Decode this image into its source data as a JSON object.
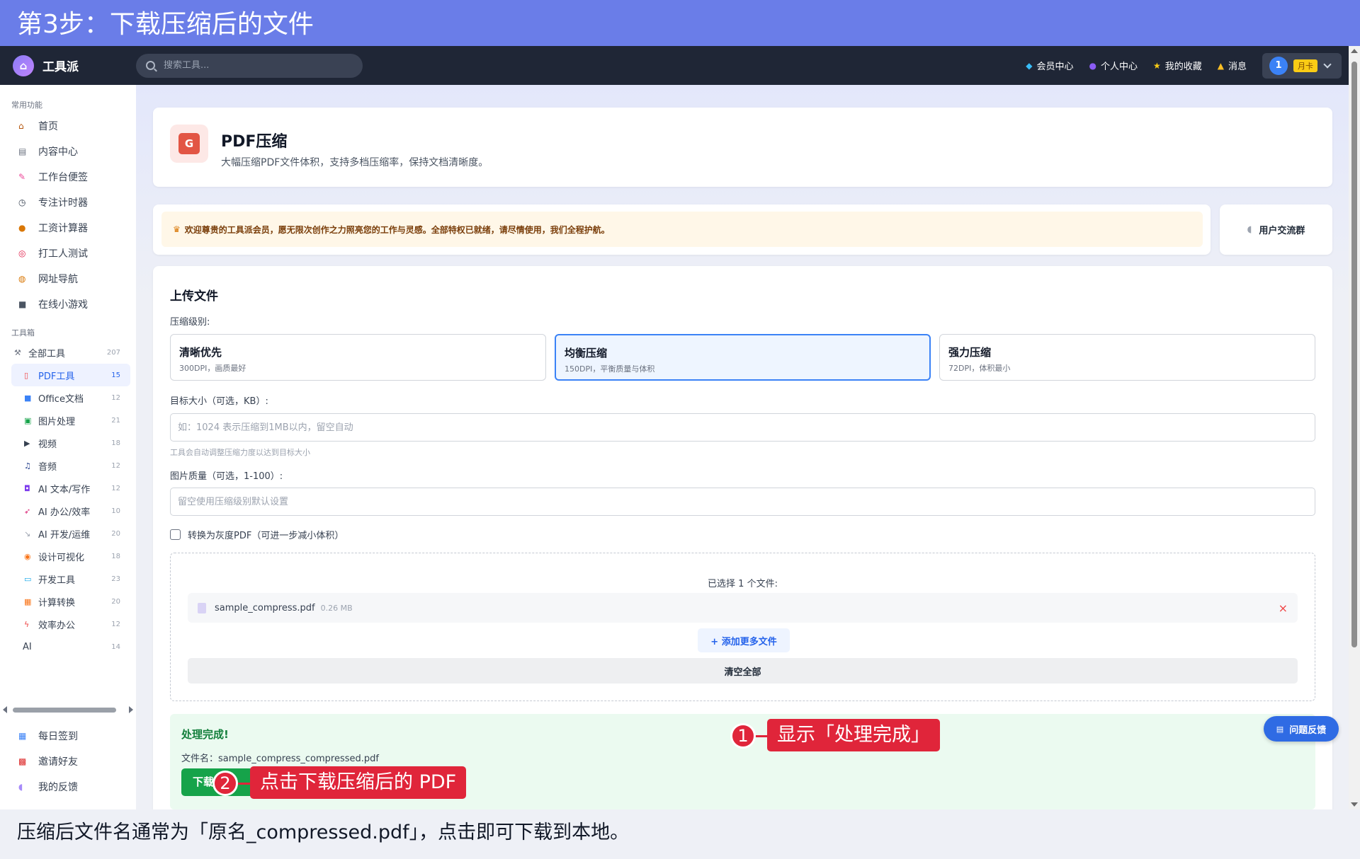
{
  "tutorial": {
    "step_title": "第3步：下载压缩后的文件",
    "caption": "压缩后文件名通常为「原名_compressed.pdf」，点击即可下载到本地。",
    "callouts": [
      {
        "number": "1",
        "text": "显示「处理完成」"
      },
      {
        "number": "2",
        "text": "点击下载压缩后的 PDF"
      }
    ]
  },
  "topnav": {
    "brand": "工具派",
    "search_placeholder": "搜索工具...",
    "links": [
      {
        "icon": "diamond-icon",
        "label": "会员中心"
      },
      {
        "icon": "user-icon",
        "label": "个人中心"
      },
      {
        "icon": "star-icon",
        "label": "我的收藏"
      },
      {
        "icon": "bell-icon",
        "label": "消息"
      }
    ],
    "user": {
      "avatar": "1",
      "plan": "月卡"
    }
  },
  "sidebar": {
    "common_title": "常用功能",
    "common": [
      {
        "icon": "home-icon",
        "label": "首页"
      },
      {
        "icon": "news-icon",
        "label": "内容中心"
      },
      {
        "icon": "memo-icon",
        "label": "工作台便签"
      },
      {
        "icon": "timer-icon",
        "label": "专注计时器"
      },
      {
        "icon": "money-bag-icon",
        "label": "工资计算器"
      },
      {
        "icon": "target-icon",
        "label": "打工人测试"
      },
      {
        "icon": "link-icon",
        "label": "网址导航"
      },
      {
        "icon": "gamepad-icon",
        "label": "在线小游戏"
      }
    ],
    "tools_title": "工具箱",
    "tools": [
      {
        "icon": "tools-icon",
        "label": "全部工具",
        "count": "207"
      },
      {
        "icon": "pdf-icon",
        "label": "PDF工具",
        "count": "15",
        "active": true
      },
      {
        "icon": "office-icon",
        "label": "Office文档",
        "count": "12"
      },
      {
        "icon": "image-icon",
        "label": "图片处理",
        "count": "21"
      },
      {
        "icon": "video-icon",
        "label": "视频",
        "count": "18"
      },
      {
        "icon": "music-icon",
        "label": "音频",
        "count": "12"
      },
      {
        "icon": "robot-icon",
        "label": "AI 文本/写作",
        "count": "12"
      },
      {
        "icon": "rocket-icon",
        "label": "AI 办公/效率",
        "count": "10"
      },
      {
        "icon": "wrench-icon",
        "label": "AI 开发/运维",
        "count": "20"
      },
      {
        "icon": "palette-icon",
        "label": "设计可视化",
        "count": "18"
      },
      {
        "icon": "monitor-icon",
        "label": "开发工具",
        "count": "23"
      },
      {
        "icon": "calculator-icon",
        "label": "计算转换",
        "count": "20"
      },
      {
        "icon": "lightning-icon",
        "label": "效率办公",
        "count": "12"
      },
      {
        "icon": "",
        "label": "AI",
        "count": "14"
      }
    ],
    "bottom": [
      {
        "icon": "calendar-icon",
        "label": "每日签到"
      },
      {
        "icon": "gift-icon",
        "label": "邀请好友"
      },
      {
        "icon": "chat-icon",
        "label": "我的反馈"
      }
    ]
  },
  "header": {
    "title": "PDF压缩",
    "description": "大幅压缩PDF文件体积，支持多档压缩率，保持文档清晰度。"
  },
  "welcome": {
    "text": "欢迎尊贵的工具派会员，愿无限次创作之力照亮您的工作与灵感。全部特权已就绪，请尽情使用，我们全程护航。",
    "group_label": "用户交流群"
  },
  "upload": {
    "title": "上传文件",
    "level_label": "压缩级别:",
    "levels": [
      {
        "title": "清晰优先",
        "desc": "300DPI，画质最好",
        "selected": false
      },
      {
        "title": "均衡压缩",
        "desc": "150DPI，平衡质量与体积",
        "selected": true
      },
      {
        "title": "强力压缩",
        "desc": "72DPI，体积最小",
        "selected": false
      }
    ],
    "target_label": "目标大小（可选，KB）:",
    "target_placeholder": "如：1024 表示压缩到1MB以内，留空自动",
    "target_value": "",
    "target_hint": "工具会自动调整压缩力度以达到目标大小",
    "quality_label": "图片质量（可选，1-100）:",
    "quality_placeholder": "留空使用压缩级别默认设置",
    "quality_value": "",
    "grayscale_label": "转换为灰度PDF（可进一步减小体积）",
    "grayscale_checked": false,
    "selected_count_text": "已选择 1 个文件:",
    "files": [
      {
        "name": "sample_compress.pdf",
        "size": "0.26 MB"
      }
    ],
    "remove_symbol": "×",
    "add_more": "+ 添加更多文件",
    "clear_all": "清空全部"
  },
  "result": {
    "title": "处理完成!",
    "filename": "文件名：sample_compress_compressed.pdf",
    "download_label": "下载"
  },
  "feedback_button": "问题反馈"
}
